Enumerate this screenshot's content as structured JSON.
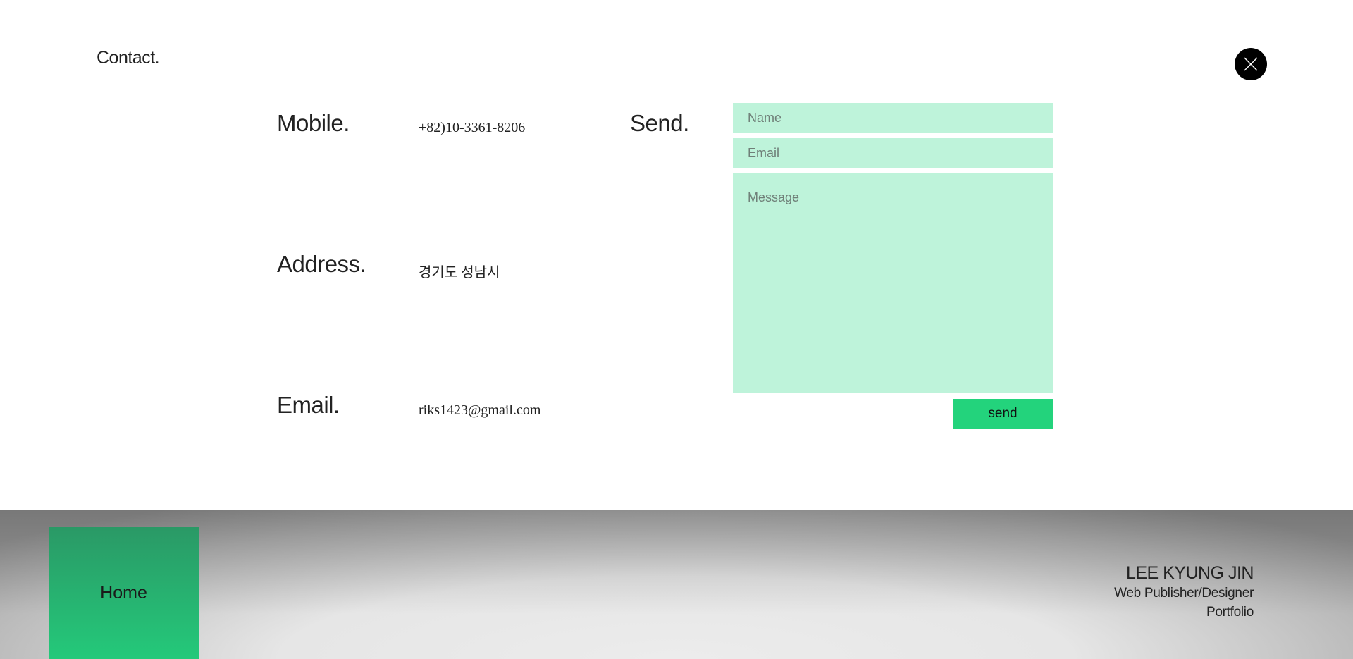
{
  "contact": {
    "title": "Contact.",
    "close_icon": "close-icon",
    "info": {
      "mobile_label": "Mobile.",
      "mobile_value": "+82)10-3361-8206",
      "address_label": "Address.",
      "address_value": "경기도 성남시",
      "email_label": "Email.",
      "email_value": "riks1423@gmail.com"
    },
    "form": {
      "send_label": "Send.",
      "name_placeholder": "Name",
      "email_placeholder": "Email",
      "message_placeholder": "Message",
      "submit_label": "send"
    }
  },
  "footer": {
    "home_label": "Home",
    "profile_name": "LEE KYUNG JIN",
    "profile_role": "Web Publisher/Designer",
    "profile_sub": "Portfolio"
  },
  "colors": {
    "field_bg": "#bef3da",
    "button_bg": "#23d37c",
    "home_tile_top": "#2a9966",
    "home_tile_bottom": "#24c97a"
  }
}
